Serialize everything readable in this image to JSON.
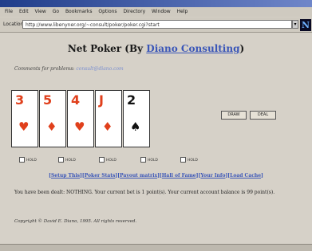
{
  "browser": {
    "menu": [
      "File",
      "Edit",
      "View",
      "Go",
      "Bookmarks",
      "Options",
      "Directory",
      "Window",
      "Help"
    ],
    "location_label": "Location:",
    "url": "http://www.libenyner.org/~consult/poker/poker.cgi?start",
    "logo": "N"
  },
  "page": {
    "title_prefix": "Net Poker (By ",
    "title_link": "Diano Consulting",
    "title_suffix": ")",
    "comments_label": "Comments for problems:",
    "comments_email": "consult@diano.com",
    "cards": [
      {
        "rank": "3",
        "suit": "♥",
        "color": "#e0401c"
      },
      {
        "rank": "5",
        "suit": "♦",
        "color": "#e0401c"
      },
      {
        "rank": "4",
        "suit": "♥",
        "color": "#e0401c"
      },
      {
        "rank": "J",
        "suit": "♦",
        "color": "#e0401c"
      },
      {
        "rank": "2",
        "suit": "♠",
        "color": "#111111"
      }
    ],
    "draw_label": "DRAW",
    "deal_label": "DEAL",
    "hold_label": "HOLD",
    "links": [
      "Setup This",
      "Poker Stats",
      "Payout matrix",
      "Hall of Fame",
      "Your Info",
      "Load Cache"
    ],
    "status_text": "You have been dealt: NOTHING. Your current bet is 1 point(s). Your current account balance is 99 point(s).",
    "copyright": "Copyright © David E. Diano, 1995. All rights reserved."
  }
}
